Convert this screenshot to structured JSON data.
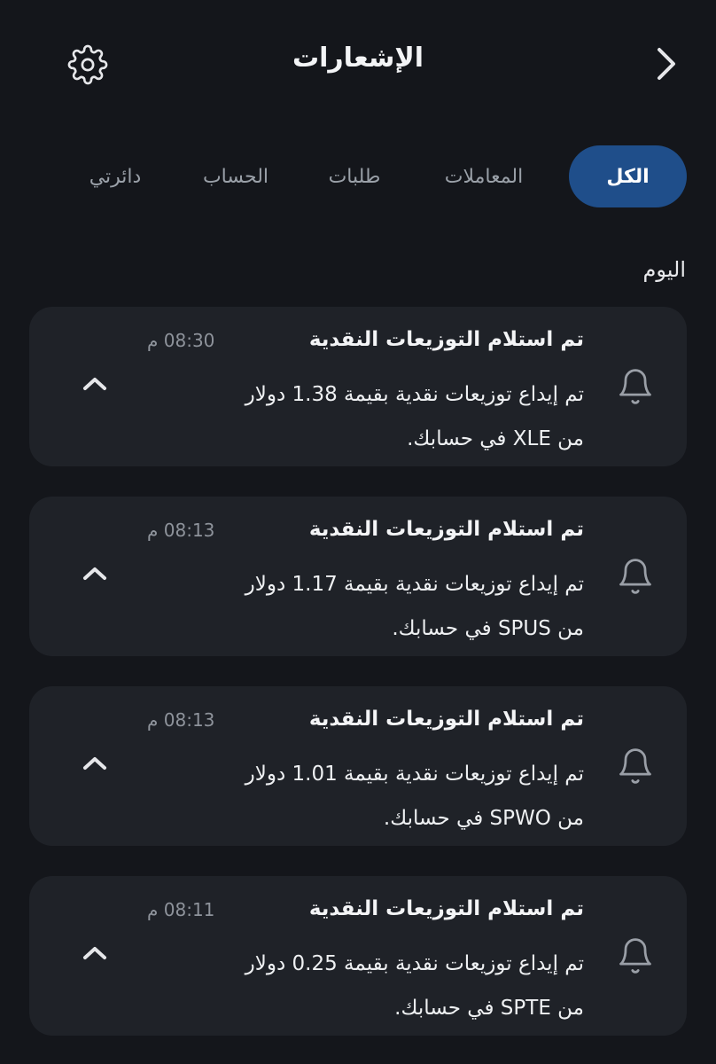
{
  "header": {
    "title": "الإشعارات",
    "settings_icon": "gear-icon",
    "back_icon": "chevron-right-icon"
  },
  "tabs": [
    {
      "label": "الكل",
      "active": true
    },
    {
      "label": "المعاملات",
      "active": false
    },
    {
      "label": "طلبات",
      "active": false
    },
    {
      "label": "الحساب",
      "active": false
    },
    {
      "label": "دائرتي",
      "active": false
    }
  ],
  "section_label": "اليوم",
  "notifications": [
    {
      "title": "تم استلام التوزيعات النقدية",
      "time": "08:30 م",
      "line1": "تم إيداع توزيعات نقدية بقيمة 1.38 دولار",
      "line2": "من XLE في حسابك."
    },
    {
      "title": "تم استلام التوزيعات النقدية",
      "time": "08:13 م",
      "line1": "تم إيداع توزيعات نقدية بقيمة 1.17 دولار",
      "line2": "من SPUS في حسابك."
    },
    {
      "title": "تم استلام التوزيعات النقدية",
      "time": "08:13 م",
      "line1": "تم إيداع توزيعات نقدية بقيمة 1.01 دولار",
      "line2": "من SPWO في حسابك."
    },
    {
      "title": "تم استلام التوزيعات النقدية",
      "time": "08:11 م",
      "line1": "تم إيداع توزيعات نقدية بقيمة 0.25 دولار",
      "line2": "من SPTE في حسابك."
    }
  ],
  "colors": {
    "background": "#14161b",
    "card": "#1f2228",
    "active_tab": "#1f4e8a",
    "muted_text": "#9aa0a8"
  }
}
